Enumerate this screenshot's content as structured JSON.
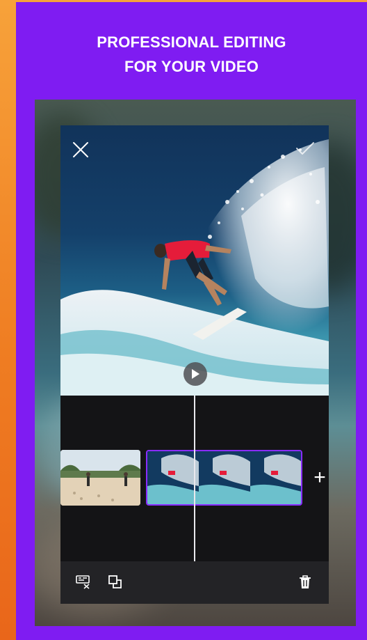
{
  "promo": {
    "headline_line1": "PROFESSIONAL EDITING",
    "headline_line2": "FOR YOUR VIDEO"
  },
  "colors": {
    "brand_purple": "#7f1cf2",
    "outer_orange": "#ef7d22",
    "selected_clip_border": "#8a2cff",
    "timeline_bg": "#141416",
    "toolbar_bg": "#232326"
  },
  "editor": {
    "top_bar": {
      "close_icon": "close-icon",
      "confirm_icon": "check-icon"
    },
    "preview": {
      "play_icon": "play-icon",
      "content": "surfer-on-wave"
    },
    "timeline": {
      "clips": [
        {
          "name": "beach-clip",
          "selected": false
        },
        {
          "name": "surf-clip",
          "selected": true
        }
      ],
      "add_clip_label": "+"
    },
    "toolbar": {
      "left_tools": [
        "cut-icon",
        "duplicate-icon"
      ],
      "right_tools": [
        "trash-icon"
      ]
    }
  }
}
